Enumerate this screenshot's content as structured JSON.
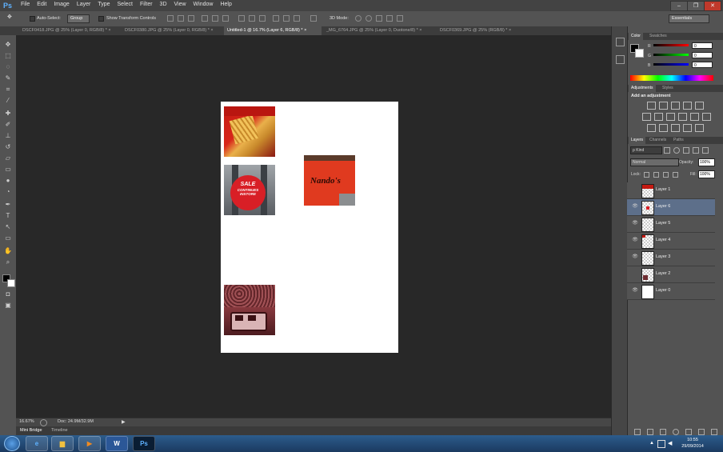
{
  "app": {
    "logo": "Ps"
  },
  "menu": [
    "File",
    "Edit",
    "Image",
    "Layer",
    "Type",
    "Select",
    "Filter",
    "3D",
    "View",
    "Window",
    "Help"
  ],
  "window_controls": {
    "minimize": "–",
    "restore": "❐",
    "close": "✕"
  },
  "options_bar": {
    "auto_select_label": "Auto-Select:",
    "auto_select_value": "Group",
    "show_transform_label": "Show Transform Controls",
    "mode_3d_label": "3D Mode:",
    "workspace": "Essentials"
  },
  "tabs": [
    {
      "label": "DSCF0418.JPG @ 25% (Layer 0, RGB/8) *"
    },
    {
      "label": "DSCF0380.JPG @ 25% (Layer 0, RGB/8) *"
    },
    {
      "label": "Untitled-1 @ 16.7% (Layer 6, RGB/8) *"
    },
    {
      "label": "_MG_6764.JPG @ 25% (Layer 0, Duotone/8) *"
    },
    {
      "label": "DSCF0369.JPG @ 25% (RGB/8) *"
    }
  ],
  "tab_close": "×",
  "canvas": {
    "sale_text_1": "SALE",
    "sale_text_2": "CONTINUES",
    "sale_text_3": "INSTORE",
    "nandos_text": "Nando's"
  },
  "status": {
    "zoom": "16.67%",
    "doc": "Doc: 24.9M/32.9M"
  },
  "mini_bridge": {
    "tab1": "Mini Bridge",
    "tab2": "Timeline"
  },
  "color_panel": {
    "tab_color": "Color",
    "tab_swatches": "Swatches",
    "r_label": "R",
    "g_label": "G",
    "b_label": "B",
    "r_value": "0",
    "g_value": "0",
    "b_value": "0"
  },
  "adjustments_panel": {
    "tab_adjustments": "Adjustments",
    "tab_styles": "Styles",
    "heading": "Add an adjustment"
  },
  "layers_panel": {
    "tab_layers": "Layers",
    "tab_channels": "Channels",
    "tab_paths": "Paths",
    "kind": "ρ Kind",
    "blend_mode": "Normal",
    "opacity_label": "Opacity:",
    "opacity_value": "100%",
    "lock_label": "Lock:",
    "fill_label": "Fill:",
    "fill_value": "100%",
    "layers": [
      {
        "name": "Layer 1",
        "visible": false,
        "selected": false
      },
      {
        "name": "Layer 6",
        "visible": true,
        "selected": true
      },
      {
        "name": "Layer 5",
        "visible": true,
        "selected": false
      },
      {
        "name": "Layer 4",
        "visible": true,
        "selected": false
      },
      {
        "name": "Layer 3",
        "visible": true,
        "selected": false
      },
      {
        "name": "Layer 2",
        "visible": false,
        "selected": false
      },
      {
        "name": "Layer 0",
        "visible": true,
        "selected": false
      }
    ]
  },
  "taskbar": {
    "time": "10:55",
    "date": "29/09/2014"
  },
  "colors": {
    "accent": "#5fb2ff",
    "selected_layer": "#5d6f8a",
    "canvas_bg": "#282828",
    "nandos_red": "#e03a1f"
  }
}
